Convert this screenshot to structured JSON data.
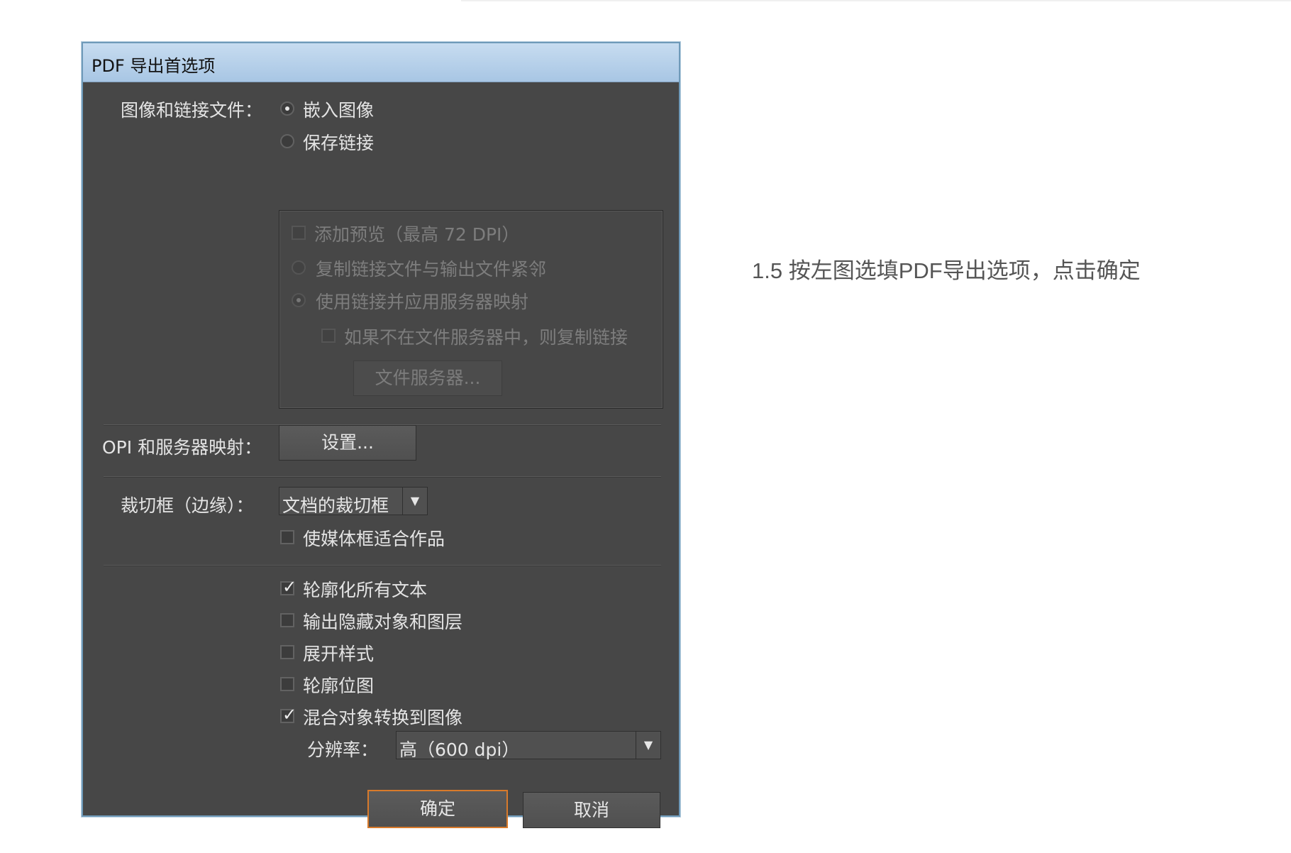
{
  "dialog": {
    "title": "PDF 导出首选项",
    "images_links_label": "图像和链接文件：",
    "embed_images": "嵌入图像",
    "preserve_links": "保存链接",
    "add_preview": "添加预览（最高 72 DPI）",
    "copy_linked": "复制链接文件与输出文件紧邻",
    "use_links_server": "使用链接并应用服务器映射",
    "copy_if_not_server": "如果不在文件服务器中，则复制链接",
    "file_servers_button": "文件服务器...",
    "opi_label": "OPI 和服务器映射：",
    "settings_button": "设置...",
    "crop_label": "裁切框（边缘）：",
    "crop_value": "文档的裁切框",
    "fit_media": "使媒体框适合作品",
    "outline_text": "轮廓化所有文本",
    "export_hidden": "输出隐藏对象和图层",
    "expand_styles": "展开样式",
    "outline_bitmaps": "轮廓位图",
    "convert_blended": "混合对象转换到图像",
    "resolution_label": "分辨率：",
    "resolution_value": "高（600 dpi）",
    "ok_button": "确定",
    "cancel_button": "取消"
  },
  "state": {
    "embed_images": true,
    "preserve_links": false,
    "outline_text": true,
    "export_hidden": false,
    "expand_styles": false,
    "outline_bitmaps": false,
    "convert_blended": true,
    "fit_media": false
  },
  "instruction": "1.5 按左图选填PDF导出选项，点击确定",
  "colors": {
    "dialog_bg": "#474747",
    "titlebar": "#b3cde8",
    "accent": "#d87a2b"
  },
  "icons": [
    "radio-icon",
    "checkbox-icon",
    "check-mark-icon",
    "dropdown-arrow-icon"
  ]
}
